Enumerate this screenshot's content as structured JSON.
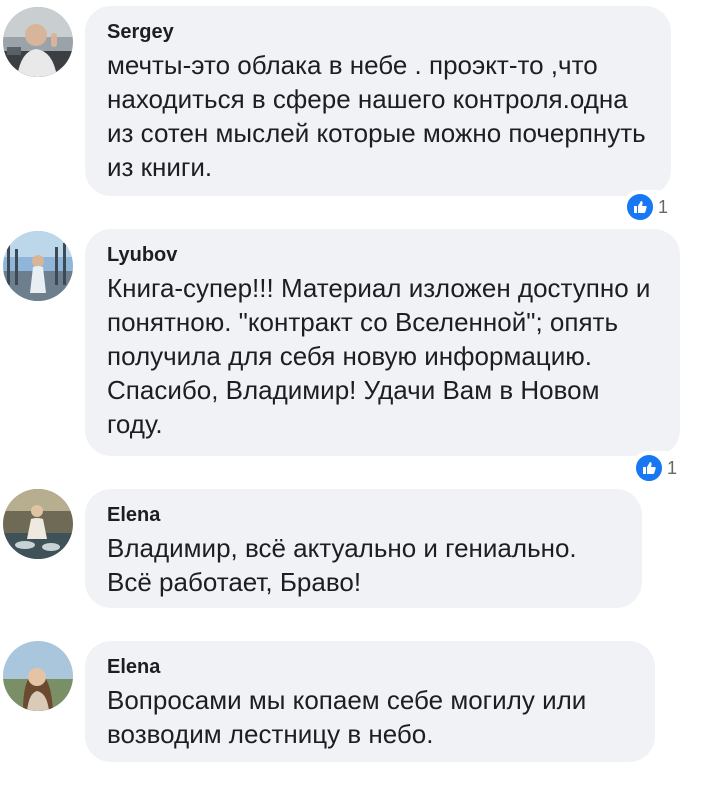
{
  "comments": [
    {
      "author": "Sergey",
      "text": "мечты-это облака в небе . проэкт-то ,что находиться в сфере нашего контроля.одна из сотен мыслей которые можно почерпнуть из книги.",
      "reactions": {
        "icon": "like-icon",
        "count": "1"
      }
    },
    {
      "author": "Lyubov",
      "text": "Книга-супер!!!  Материал изложен доступно и понятною.  \"контракт со Вселенной\"; опять получила  для себя новую информацию. Спасибо, Владимир! Удачи Вам в Новом году.",
      "reactions": {
        "icon": "like-icon",
        "count": "1"
      }
    },
    {
      "author": "Elena",
      "text": "Владимир,  всё актуально и гениально. Всё работает,  Браво!"
    },
    {
      "author": "Elena",
      "text": "Вопросами мы копаем себе могилу или возводим лестницу в небо."
    }
  ],
  "colors": {
    "bubble": "#f0f2f5",
    "like": "#1877f2",
    "text": "#1c1e21",
    "muted": "#65676b"
  }
}
